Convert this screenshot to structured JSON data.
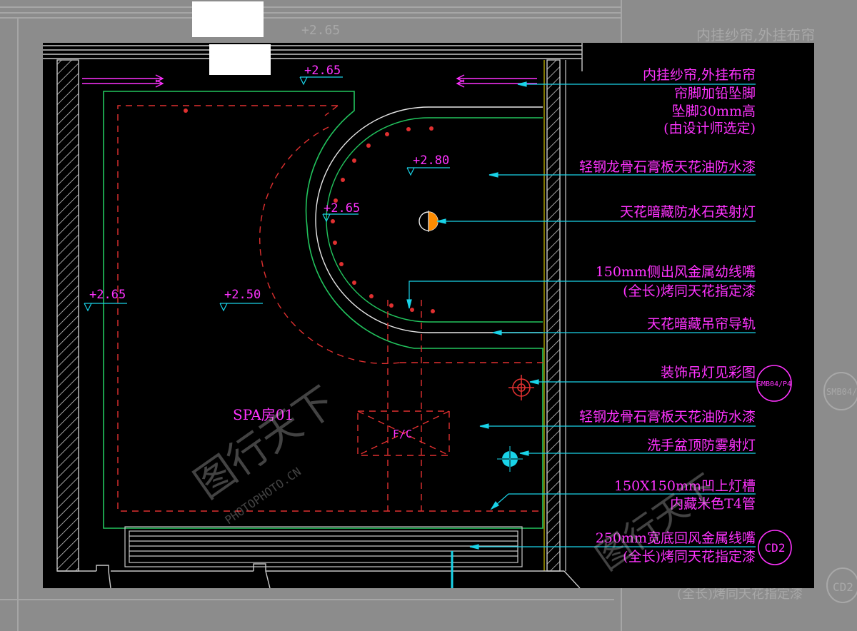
{
  "colors": {
    "background": "#000000",
    "frame_outside": "#8c8c8c",
    "annotation": "#ff33ff",
    "leader": "#19d3e8",
    "ceiling_outline": "#22c55e",
    "dashed": "#e03030",
    "curtain_track": "#ffffff",
    "wall": "#c8c8c8",
    "level_mark": "#19d3e8"
  },
  "background_labels": {
    "elev": "+2.65",
    "tr1": "内挂纱帘,外挂布帘",
    "tag1": "SMB04/P4",
    "tag2": "CD2",
    "bottom": "(全长)烤同天花指定漆"
  },
  "levels": {
    "top": "+2.65",
    "curve_center": "+2.80",
    "curve_left": "+2.65",
    "left_wall": "+2.65",
    "main": "+2.50"
  },
  "room_label": "SPA房01",
  "fixture_label": "F/C",
  "annotations": {
    "a1": [
      "内挂纱帘,外挂布帘",
      "帘脚加铅坠脚",
      "坠脚30mm高",
      "(由设计师选定)"
    ],
    "a2": "轻钢龙骨石膏板天花油防水漆",
    "a3": "天花暗藏防水石英射灯",
    "a4": [
      "150mm侧出风金属幼线嘴",
      "(全长)烤同天花指定漆"
    ],
    "a5": "天花暗藏吊帘导轨",
    "a6": "装饰吊灯见彩图",
    "a7": "轻钢龙骨石膏板天花油防水漆",
    "a8": "洗手盆顶防雾射灯",
    "a9": [
      "150X150mm凹上灯槽",
      "内藏米色T4管"
    ],
    "a10": [
      "250mm宽底回风金属线嘴",
      "(全长)烤同天花指定漆"
    ]
  },
  "tags": {
    "pendant": "SMB04/P4",
    "vent": "CD2"
  },
  "watermark": {
    "brand": "图行天下",
    "site": "PHOTOPHOTO.CN"
  }
}
